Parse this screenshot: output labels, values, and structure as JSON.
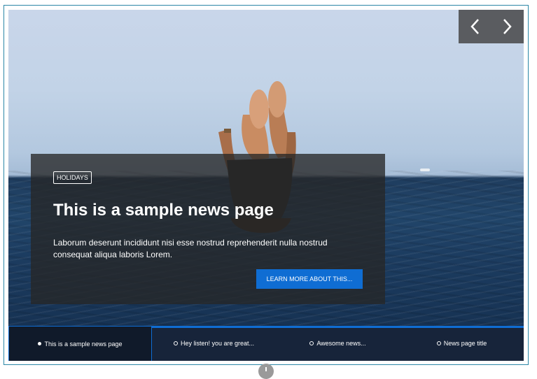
{
  "hero": {
    "tag": "HOLIDAYS",
    "title": "This is a sample news page",
    "description": "Laborum deserunt incididunt nisi esse nostrud reprehenderit nulla nostrud consequat aliqua laboris Lorem.",
    "cta_label": "LEARN MORE ABOUT THIS..."
  },
  "nav": {
    "prev_icon": "chevron-left-icon",
    "next_icon": "chevron-right-icon"
  },
  "thumbnails": [
    {
      "label": "This is a sample news page",
      "active": true
    },
    {
      "label": "Hey listen! you are great...",
      "active": false
    },
    {
      "label": "Awesome news...",
      "active": false
    },
    {
      "label": "News page title",
      "active": false
    }
  ],
  "colors": {
    "accent": "#0f6dd3",
    "caption_bg": "#262626",
    "nav_bg": "#5a5c60",
    "thumb_bar_bg": "#17243a"
  }
}
